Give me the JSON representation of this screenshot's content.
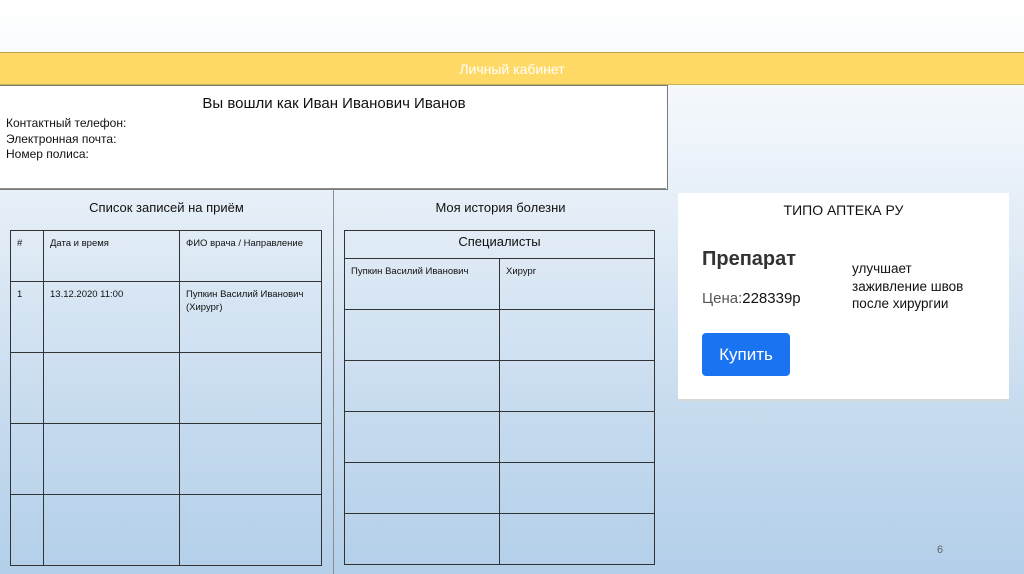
{
  "header": {
    "title": "Личный кабинет"
  },
  "profile": {
    "greeting": "Вы вошли как Иван Иванович Иванов",
    "phone_label": "Контактный телефон:",
    "email_label": "Электронная почта:",
    "policy_label": "Номер полиса:"
  },
  "appointments": {
    "title": "Список записей на приём",
    "columns": [
      "#",
      "Дата и время",
      "ФИО врача / Направление"
    ],
    "rows": [
      [
        "1",
        "13.12.2020 11:00",
        "Пупкин Василий Иванович (Хирург)"
      ],
      [
        "",
        "",
        ""
      ],
      [
        "",
        "",
        ""
      ],
      [
        "",
        "",
        ""
      ]
    ]
  },
  "history": {
    "title": "Моя история болезни",
    "table_header": "Специалисты",
    "rows": [
      [
        "Пупкин Василий Иванович",
        "Хирург"
      ],
      [
        "",
        ""
      ],
      [
        "",
        ""
      ],
      [
        "",
        ""
      ],
      [
        "",
        ""
      ],
      [
        "",
        ""
      ]
    ]
  },
  "pharmacy": {
    "title": "ТИПО АПТЕКА РУ",
    "product": "Препарат",
    "price_label": "Цена:",
    "price_value": "228339р",
    "description": "улучшает заживление швов после хирургии",
    "buy_label": "Купить"
  },
  "footer": {
    "page_number": "6"
  }
}
